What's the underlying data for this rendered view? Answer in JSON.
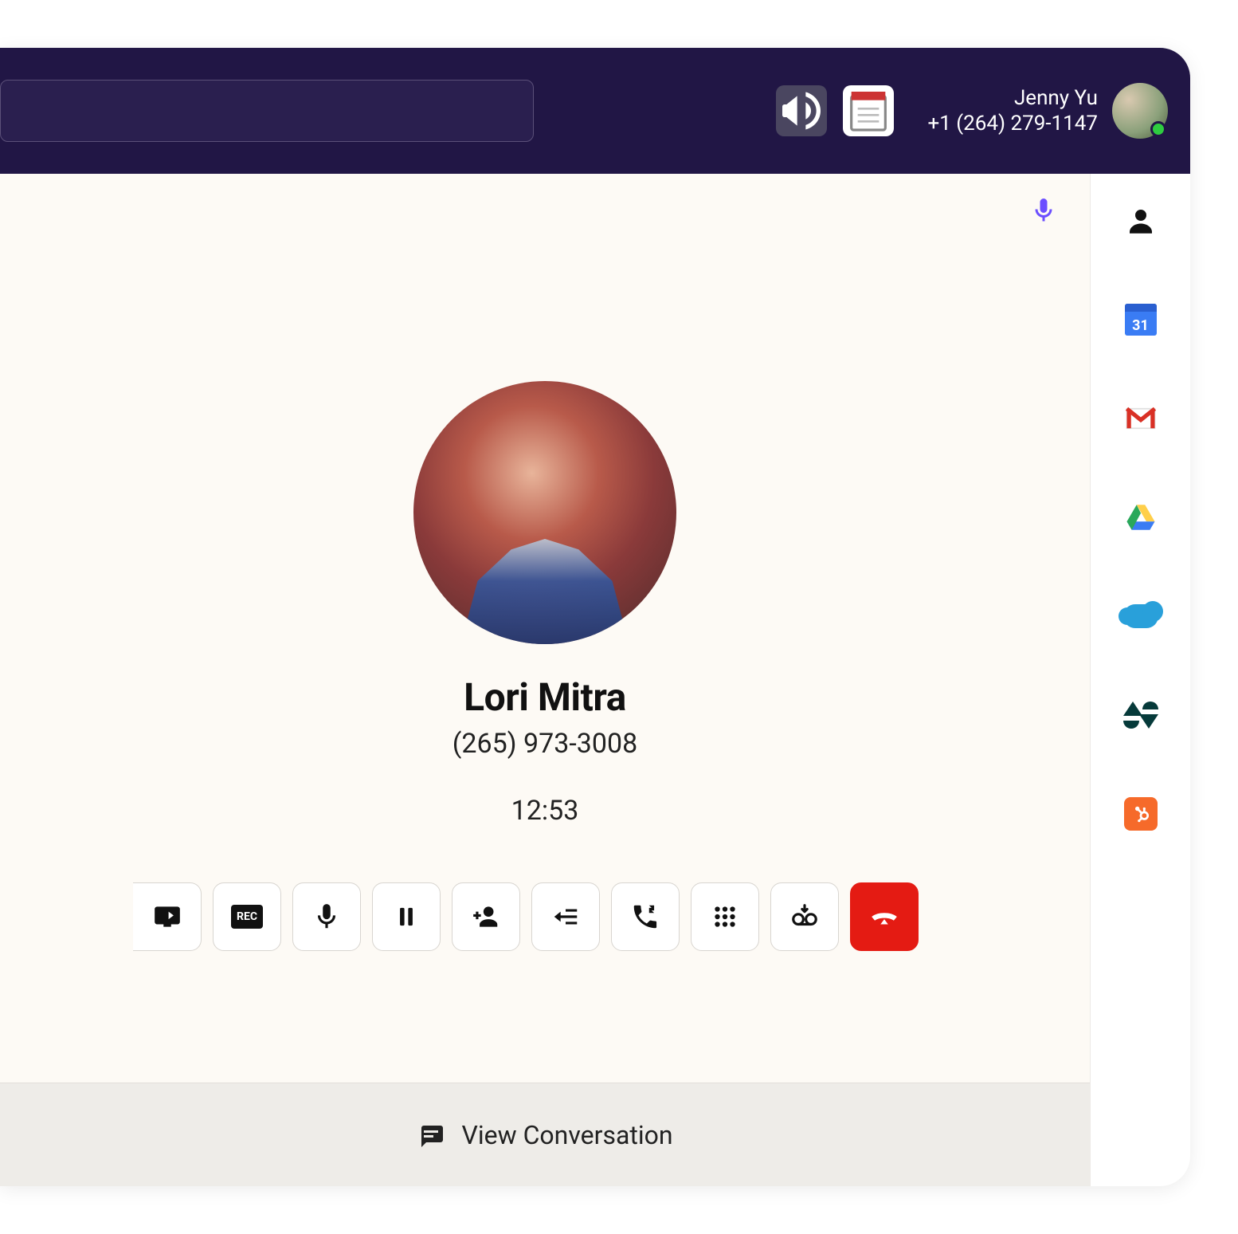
{
  "header": {
    "user_name": "Jenny Yu",
    "user_phone": "+1 (264) 279-1147"
  },
  "call": {
    "contact_name": "Lori Mitra",
    "contact_phone": "(265) 973-3008",
    "duration": "12:53"
  },
  "footer": {
    "view_conversation": "View Conversation"
  },
  "calendar_day": "31"
}
